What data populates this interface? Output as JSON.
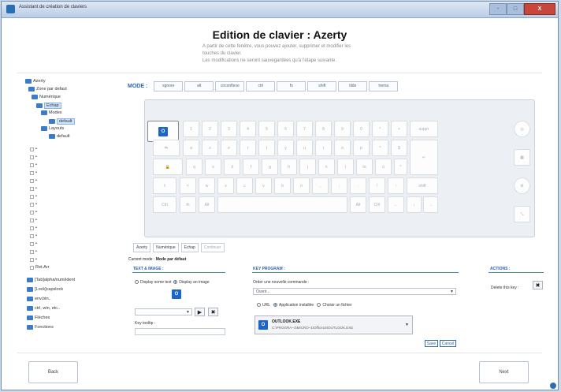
{
  "window": {
    "title": "Assistant de création de claviers",
    "min": "-",
    "max": "□",
    "close": "X"
  },
  "header": {
    "title": "Edition de clavier : Azerty",
    "sub_lines": [
      "A partir de cette fenêtre, vous pouvez ajouter, supprimer et modifier les",
      "touches du clavier.",
      "Les modifications ne seront sauvegardées qu'à l'étape suivante."
    ]
  },
  "tree": {
    "root": "Azerty",
    "items": [
      "Zone par defaut",
      "Numérique",
      "Echap",
      "Modes",
      "default",
      "Layouts",
      "default",
      "Ret.Arr",
      "[Tab]alpha/num/ident",
      "[Lock]capslock",
      "env.btn..",
      "ctrl, win, etc..",
      "Flèches",
      "Fonctions"
    ]
  },
  "mode": {
    "label": "MODE :",
    "buttons": [
      "sgnore",
      "alt",
      "circonflexe",
      "ctrl",
      "fn",
      "shift",
      "tilde",
      "trema"
    ]
  },
  "keyboard": {
    "icon_text": "O",
    "row1": [
      "1",
      "2",
      "3",
      "4",
      "5",
      "6",
      "7",
      "8",
      "9",
      "0",
      "°",
      "+",
      "suppr"
    ],
    "row2": [
      "a",
      "z",
      "e",
      "r",
      "t",
      "y",
      "u",
      "i",
      "o",
      "p",
      "^",
      "$"
    ],
    "row3": [
      "q",
      "s",
      "d",
      "f",
      "g",
      "h",
      "j",
      "k",
      "l",
      "m",
      "ù",
      "*"
    ],
    "row4": [
      "<",
      "w",
      "x",
      "c",
      "v",
      "b",
      "n",
      ",",
      ";",
      ":",
      "!",
      "shift"
    ],
    "row5": [
      "Ctrl",
      "fn",
      "Alt",
      "Alt",
      "Ctrl"
    ]
  },
  "crumbs": [
    "Azerty",
    "Numérique",
    "Echap",
    "Continuer"
  ],
  "current_mode": {
    "label": "Current mode :",
    "value": "Mode par défaut"
  },
  "text_image": {
    "section": "TEXT & IMAGE :",
    "radio_text": "Display some text",
    "radio_image": "Display an image",
    "tooltip_label": "Key tooltip :"
  },
  "program": {
    "section": "KEY PROGRAM :",
    "command_label": "Order une nouvelle commande :",
    "command_value": "Ouvrir...",
    "radio_url": "URL",
    "radio_app": "Application installée",
    "radio_file": "Choisir un fichier",
    "app_name": "OUTLOOK.EXE",
    "app_path": "C:\\PROGRA~1\\MICRO~1\\Office15\\OUTLOOK.EXE",
    "save": "Save",
    "cancel": "Cancel"
  },
  "actions": {
    "section": "ACTIONS :",
    "delete_label": "Delete this key :"
  },
  "nav": {
    "back": "Back",
    "next": "Next"
  }
}
